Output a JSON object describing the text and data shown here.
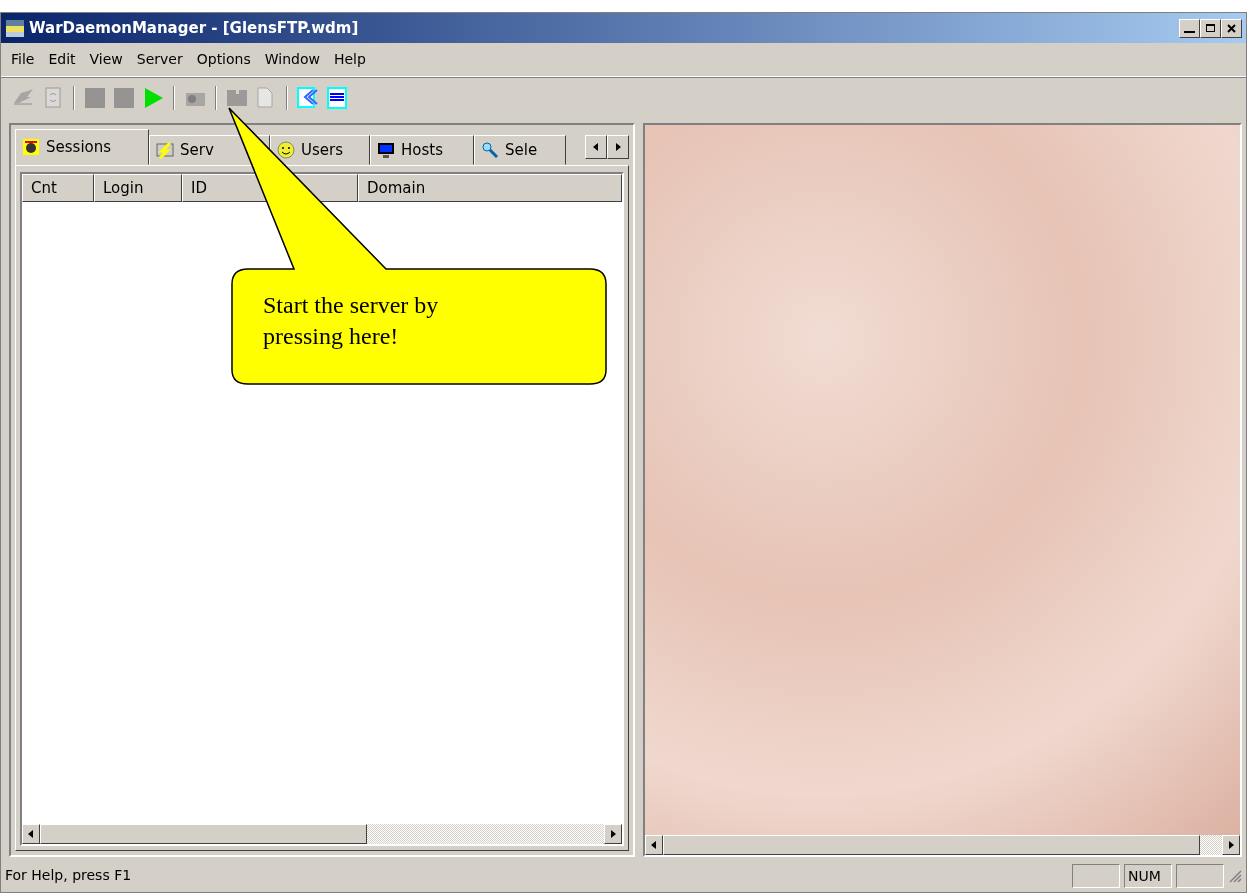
{
  "window": {
    "title": "WarDaemonManager - [GlensFTP.wdm]"
  },
  "menu": [
    "File",
    "Edit",
    "View",
    "Server",
    "Options",
    "Window",
    "Help"
  ],
  "toolbar": [
    {
      "kind": "button",
      "disabled": true
    },
    {
      "kind": "button",
      "disabled": true
    },
    {
      "kind": "separator"
    },
    {
      "kind": "button",
      "disabled": true
    },
    {
      "kind": "button",
      "disabled": true
    },
    {
      "kind": "button",
      "disabled": false
    },
    {
      "kind": "separator"
    },
    {
      "kind": "button",
      "disabled": true
    },
    {
      "kind": "separator"
    },
    {
      "kind": "button",
      "disabled": true
    },
    {
      "kind": "button",
      "disabled": true
    },
    {
      "kind": "separator"
    },
    {
      "kind": "button",
      "disabled": false
    },
    {
      "kind": "button",
      "disabled": false
    }
  ],
  "tabs": [
    {
      "label": "Sessions",
      "selected": true
    },
    {
      "label": "Serv",
      "selected": false
    },
    {
      "label": "Users",
      "selected": false
    },
    {
      "label": "Hosts",
      "selected": false
    },
    {
      "label": "Sele",
      "selected": false
    }
  ],
  "table": {
    "columns": [
      "Cnt",
      "Login",
      "ID",
      "Domain"
    ]
  },
  "callout": {
    "text": "Start the server by pressing here!"
  },
  "status_bar": {
    "text": "For Help, press F1",
    "indicators": [
      "NUM"
    ]
  }
}
